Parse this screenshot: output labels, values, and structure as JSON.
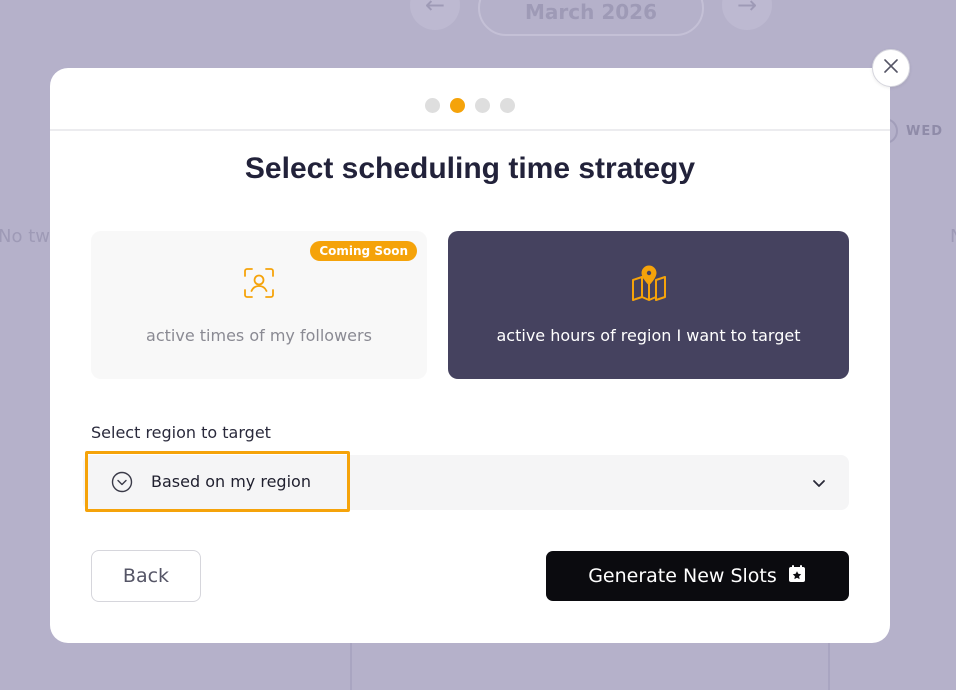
{
  "background": {
    "month": "March 2026",
    "prev_arrow": "←",
    "next_arrow": "→",
    "weekday": "WED",
    "empty_left": "No twe",
    "empty_right": "N"
  },
  "modal": {
    "close_icon": "close-icon",
    "steps": {
      "total": 4,
      "active": 2
    },
    "title": "Select scheduling time strategy",
    "options": [
      {
        "label": "active times of my followers",
        "icon": "user-focus-icon",
        "badge": "Coming Soon",
        "selected": false
      },
      {
        "label": "active hours of region I want to target",
        "icon": "map-pin-icon",
        "selected": true
      }
    ],
    "region": {
      "label": "Select region to target",
      "value": "Based on my region",
      "icon": "chevron-circle-icon"
    },
    "buttons": {
      "back": "Back",
      "generate": "Generate New Slots",
      "generate_icon": "calendar-star-icon"
    }
  },
  "colors": {
    "accent": "#f5a30a",
    "selected_card": "#45425f",
    "overlay": "#b5b1ca",
    "primary_button": "#0b0b0f"
  }
}
